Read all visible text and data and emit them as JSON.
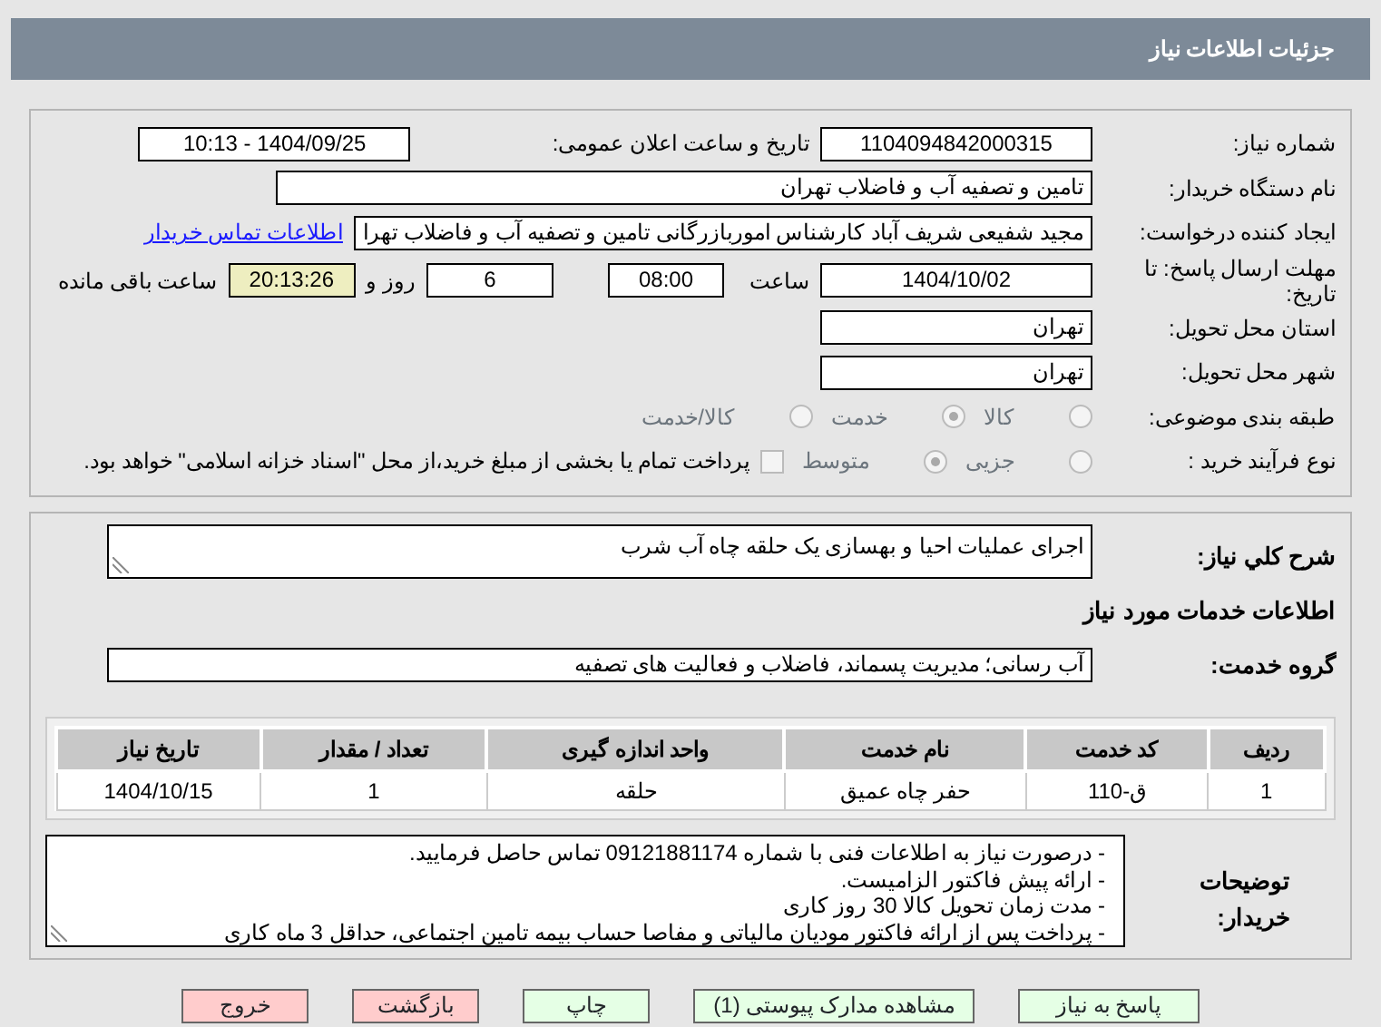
{
  "header": {
    "title": "جزئیات اطلاعات نیاز"
  },
  "need_number": {
    "label": "شماره نیاز:",
    "value": "1104094842000315"
  },
  "announce_datetime": {
    "label": "تاریخ و ساعت اعلان عمومی:",
    "value": "1404/09/25 - 10:13"
  },
  "buyer_org": {
    "label": "نام دستگاه خریدار:",
    "value": "تامین و تصفیه آب و فاضلاب تهران"
  },
  "requester": {
    "label": "ایجاد کننده درخواست:",
    "value": "مجید شفیعی شریف آباد کارشناس اموربازرگانی تامین و تصفیه آب و فاضلاب تهرا",
    "link": "اطلاعات تماس خریدار"
  },
  "deadline": {
    "label": "مهلت ارسال پاسخ: تا تاریخ:",
    "date": "1404/10/02",
    "time_label": "ساعت",
    "time": "08:00",
    "days": "6",
    "days_label": "روز و",
    "remaining": "20:13:26",
    "remaining_label": "ساعت باقی مانده"
  },
  "province": {
    "label": "استان محل تحویل:",
    "value": "تهران"
  },
  "city": {
    "label": "شهر محل تحویل:",
    "value": "تهران"
  },
  "category": {
    "label": "طبقه بندی موضوعی:",
    "options": [
      {
        "label": "کالا",
        "selected": false
      },
      {
        "label": "خدمت",
        "selected": true
      },
      {
        "label": "کالا/خدمت",
        "selected": false
      }
    ]
  },
  "purchase_type": {
    "label": "نوع فرآیند خرید :",
    "options": [
      {
        "label": "جزیی",
        "selected": false
      },
      {
        "label": "متوسط",
        "selected": true
      }
    ],
    "treasury": {
      "checked": false,
      "text": "پرداخت تمام یا بخشی از مبلغ خرید،از محل \"اسناد خزانه اسلامی\" خواهد بود."
    }
  },
  "summary": {
    "label": "شرح کلي نياز:",
    "value": "اجرای عملیات احیا و بهسازی یک حلقه چاه آب شرب"
  },
  "services_title": "اطلاعات خدمات مورد نیاز",
  "service_group": {
    "label": "گروه خدمت:",
    "value": "آب رسانی؛ مدیریت پسماند، فاضلاب و فعالیت های تصفیه"
  },
  "table": {
    "columns": [
      "ردیف",
      "کد خدمت",
      "نام خدمت",
      "واحد اندازه گیری",
      "تعداد / مقدار",
      "تاریخ نیاز"
    ],
    "rows": [
      [
        "1",
        "ق-110",
        "حفر چاه عمیق",
        "حلقه",
        "1",
        "1404/10/15"
      ]
    ]
  },
  "buyer_notes": {
    "label": "توضیحات خریدار:",
    "lines": [
      "- درصورت نیاز به اطلاعات فنی با شماره 09121881174 تماس حاصل فرمایید.",
      "- ارائه پیش فاکتور الزامیست.",
      "- مدت زمان تحویل کالا 30 روز کاری",
      "- پرداخت پس از ارائه فاکتور مودیان مالیاتی و مفاصا حساب بیمه تامین اجتماعی، حداقل 3 ماه کاری"
    ]
  },
  "buttons": [
    {
      "label": "پاسخ به نیاز",
      "kind": "go"
    },
    {
      "label": "مشاهده مدارک پیوستی (1)",
      "kind": "go"
    },
    {
      "label": "چاپ",
      "kind": "go"
    },
    {
      "label": "بازگشت",
      "kind": "stop"
    },
    {
      "label": "خروج",
      "kind": "stop"
    }
  ]
}
